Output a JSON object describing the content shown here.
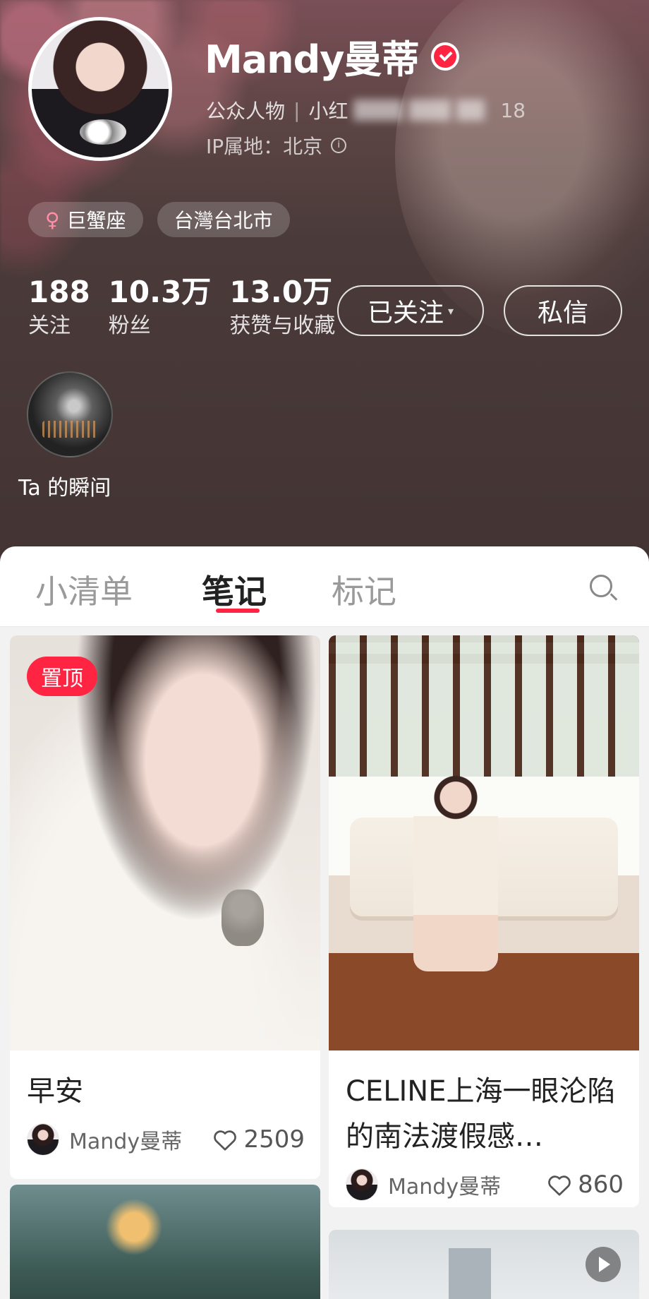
{
  "profile": {
    "name": "Mandy曼蒂",
    "meta_role": "公众人物",
    "meta_sep": "|",
    "meta_id_prefix": "小红",
    "meta_id_suffix": "18",
    "ip_location": "IP属地：北京",
    "info_glyph": "i",
    "tags": [
      {
        "icon": "female-icon",
        "symbol": "♀",
        "label": "巨蟹座"
      },
      {
        "label": "台灣台北市"
      }
    ],
    "stats": [
      {
        "value": "188",
        "label": "关注"
      },
      {
        "value": "10.3万",
        "label": "粉丝"
      },
      {
        "value": "13.0万",
        "label": "获赞与收藏"
      }
    ],
    "follow_button": "已关注",
    "follow_caret": "▾",
    "message_button": "私信",
    "moments_label": "Ta 的瞬间",
    "accent_color": "#ff2442"
  },
  "tabs": [
    {
      "label": "小清单",
      "active": false
    },
    {
      "label": "笔记",
      "active": true
    },
    {
      "label": "标记",
      "active": false
    }
  ],
  "notes": [
    {
      "pinned_label": "置顶",
      "title": "早安",
      "author": "Mandy曼蒂",
      "likes": "2509"
    },
    {
      "title": "CELINE上海一眼沦陷的南法渡假感…",
      "author": "Mandy曼蒂",
      "likes": "860"
    }
  ]
}
